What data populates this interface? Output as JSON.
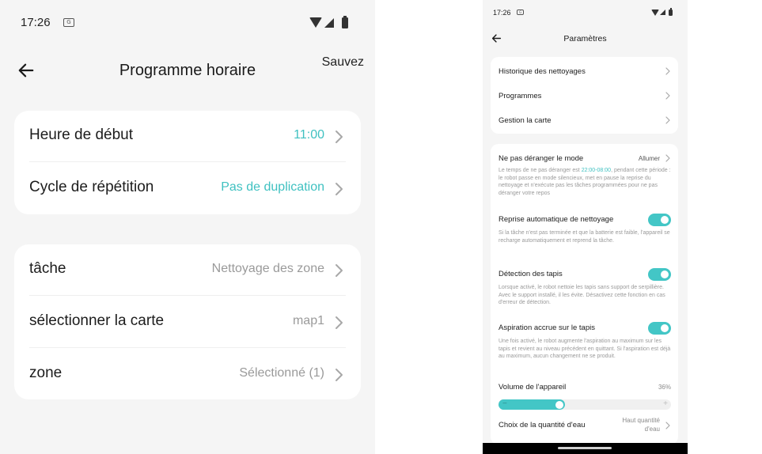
{
  "left": {
    "status": {
      "time": "17:26",
      "sim_label": "G"
    },
    "appbar": {
      "title": "Programme horaire",
      "save": "Sauvez"
    },
    "schedule_rows": [
      {
        "label": "Heure de début",
        "value": "11:00"
      },
      {
        "label": "Cycle de répétition",
        "value": "Pas de duplication"
      }
    ],
    "task_rows": [
      {
        "label": "tâche",
        "value": "Nettoyage des zone"
      },
      {
        "label": "sélectionner la carte",
        "value": "map1"
      },
      {
        "label": "zone",
        "value": "Sélectionné (1)"
      }
    ]
  },
  "right": {
    "status": {
      "time": "17:26",
      "sim_label": "G"
    },
    "appbar": {
      "title": "Paramètres"
    },
    "nav_rows": [
      {
        "label": "Historique des nettoyages"
      },
      {
        "label": "Programmes"
      },
      {
        "label": "Gestion la carte"
      }
    ],
    "dnd": {
      "label": "Ne pas déranger le mode",
      "value": "Allumer",
      "desc_before": "Le temps de ne pas déranger est ",
      "desc_time": "22:00-08:00",
      "desc_after": ", pendant cette période : le robot passe en mode silencieux, met en pause la reprise du nettoyage et n'exécute pas les tâches programmées pour ne pas déranger votre repos"
    },
    "auto_resume": {
      "label": "Reprise automatique de nettoyage",
      "enabled": true,
      "desc": "Si la tâche n'est pas terminée et que la batterie est faible, l'appareil se recharge automatiquement et reprend la tâche."
    },
    "carpet_detect": {
      "label": "Détection des tapis",
      "enabled": true,
      "desc": "Lorsque activé, le robot nettoie les tapis sans support de serpillière. Avec le support installé, il les évite. Désactivez cette fonction en cas d'erreur de détection."
    },
    "carpet_boost": {
      "label": "Aspiration accrue sur le tapis",
      "enabled": true,
      "desc": "Une fois activé, le robot augmente l'aspiration au maximum sur les tapis et revient au niveau précédent en quittant. Si l'aspiration est déjà au maximum, aucun changement ne se produit."
    },
    "volume": {
      "label": "Volume de l'appareil",
      "value_text": "36%",
      "level": 0.36,
      "minus": "−",
      "plus": "+"
    },
    "water": {
      "label": "Choix de la quantité d'eau",
      "value_line1": "Haut quantité",
      "value_line2": "d'eau"
    }
  },
  "colors": {
    "accent": "#3fc1c1",
    "toggle_on": "#43c6c6",
    "bg": "#f5f5f5",
    "card": "#ffffff"
  },
  "icons": [
    "back-arrow-icon",
    "chevron-right-icon",
    "wifi-icon",
    "signal-icon",
    "battery-icon",
    "sim-icon"
  ]
}
